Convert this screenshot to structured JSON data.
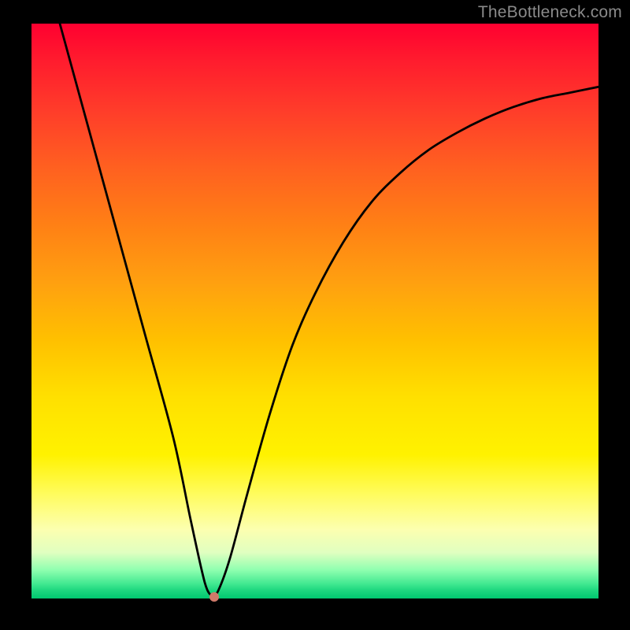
{
  "watermark": "TheBottleneck.com",
  "chart_data": {
    "type": "line",
    "title": "",
    "xlabel": "",
    "ylabel": "",
    "xlim": [
      0,
      100
    ],
    "ylim": [
      0,
      100
    ],
    "grid": false,
    "series": [
      {
        "name": "curve",
        "x": [
          5,
          10,
          15,
          20,
          25,
          28,
          30,
          31,
          32,
          33,
          35,
          38,
          42,
          46,
          50,
          55,
          60,
          65,
          70,
          75,
          80,
          85,
          90,
          95,
          100
        ],
        "y": [
          100,
          82,
          64,
          46,
          28,
          14,
          5,
          1.5,
          0.5,
          1.5,
          7,
          18,
          32,
          44,
          53,
          62,
          69,
          74,
          78,
          81,
          83.5,
          85.5,
          87,
          88,
          89
        ]
      }
    ],
    "marker": {
      "x": 32.2,
      "y": 0.3,
      "color": "#d07a6a"
    },
    "gradient_stops": [
      {
        "pos": 0,
        "color": "#ff0030"
      },
      {
        "pos": 0.25,
        "color": "#ff6020"
      },
      {
        "pos": 0.55,
        "color": "#ffc000"
      },
      {
        "pos": 0.82,
        "color": "#fffc60"
      },
      {
        "pos": 0.95,
        "color": "#90ffb0"
      },
      {
        "pos": 1.0,
        "color": "#00c870"
      }
    ]
  }
}
